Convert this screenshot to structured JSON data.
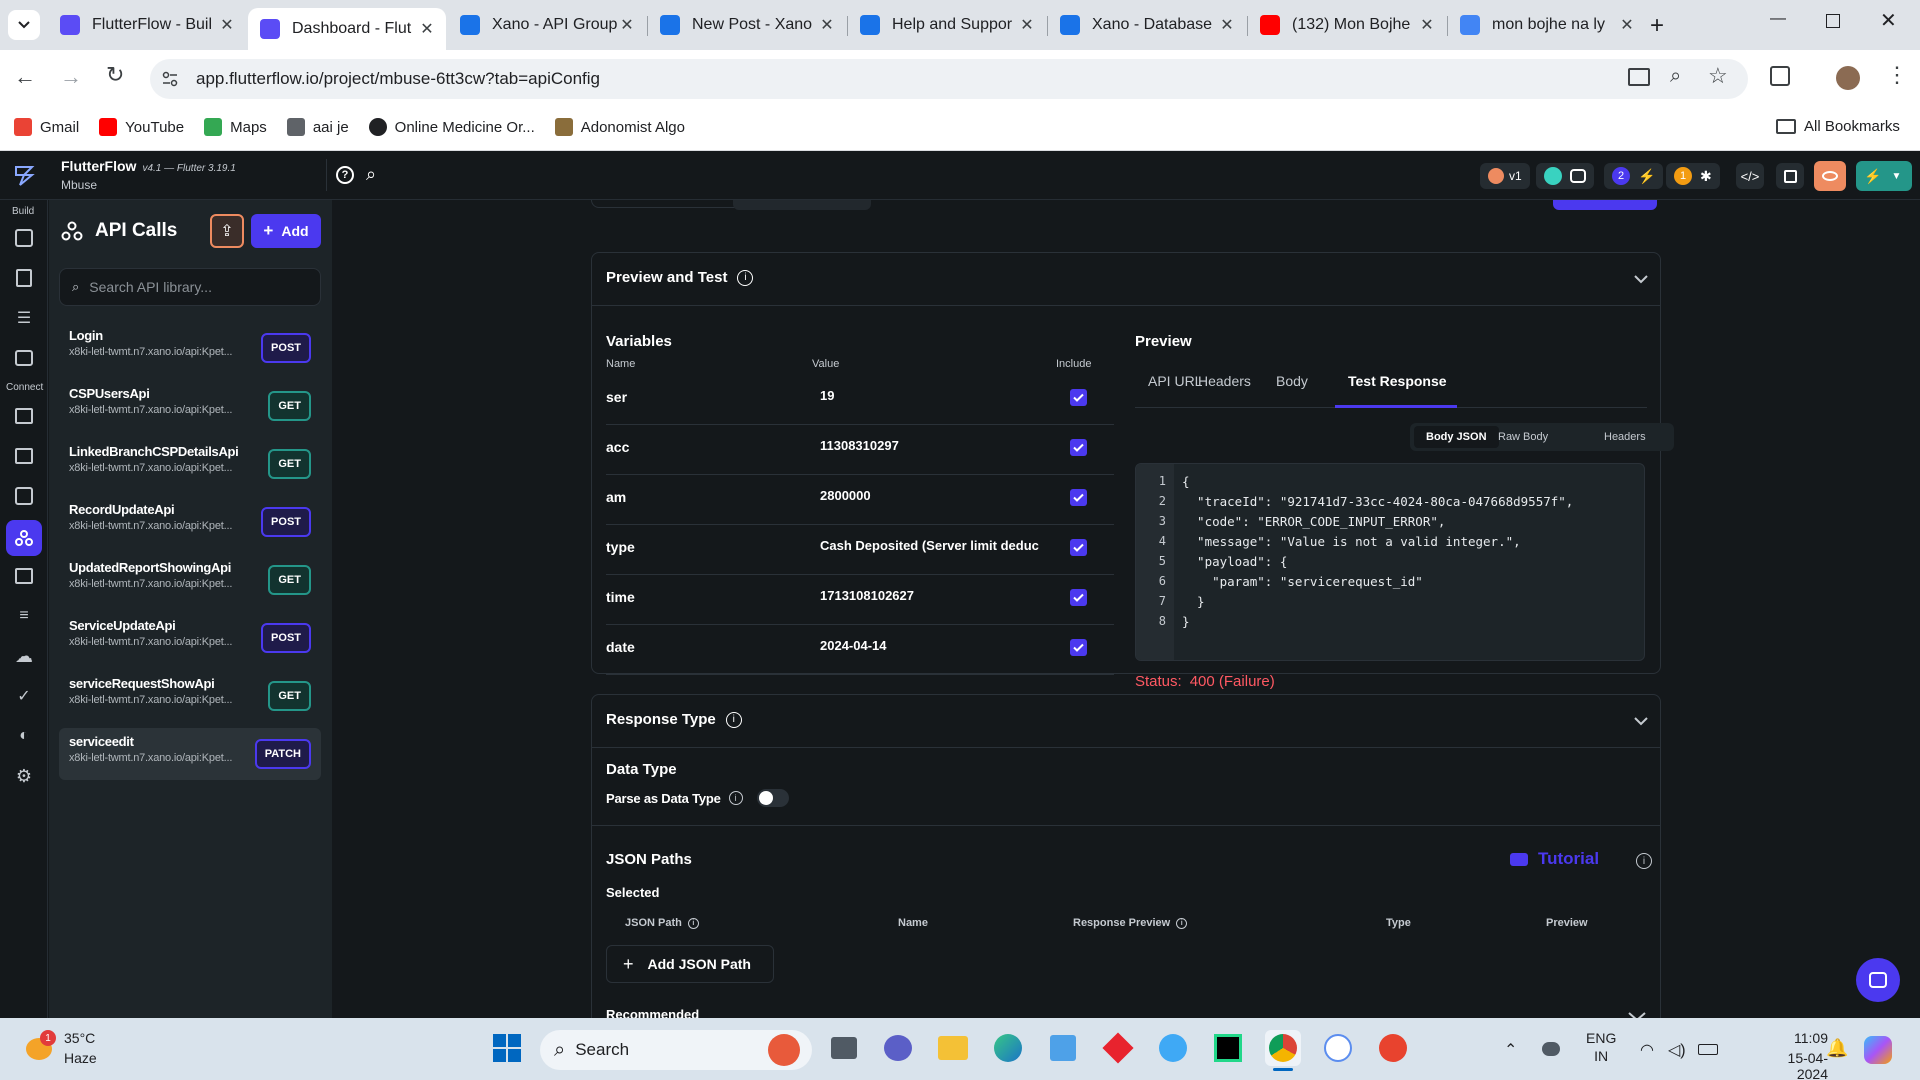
{
  "browser": {
    "tabs": [
      {
        "title": "FlutterFlow - Buil",
        "icon": "flutterflow-icon",
        "color": "#5b4cf5"
      },
      {
        "title": "Dashboard - Flut",
        "icon": "flutterflow-icon",
        "color": "#5b4cf5",
        "active": true
      },
      {
        "title": "Xano - API Group",
        "icon": "xano-icon",
        "color": "#1a73e8"
      },
      {
        "title": "New Post - Xano",
        "icon": "xano-icon",
        "color": "#1a73e8"
      },
      {
        "title": "Help and Suppor",
        "icon": "xano-icon",
        "color": "#1a73e8"
      },
      {
        "title": "Xano - Database",
        "icon": "xano-icon",
        "color": "#1a73e8"
      },
      {
        "title": "(132) Mon Bojhe",
        "icon": "youtube-icon",
        "color": "#ff0000"
      },
      {
        "title": "mon bojhe na ly",
        "icon": "google-icon",
        "color": "#4285f4"
      }
    ],
    "url": "app.flutterflow.io/project/mbuse-6tt3cw?tab=apiConfig",
    "bookmarks": [
      {
        "label": "Gmail",
        "icon": "gmail-icon"
      },
      {
        "label": "YouTube",
        "icon": "youtube-icon"
      },
      {
        "label": "Maps",
        "icon": "maps-icon"
      },
      {
        "label": "aai je",
        "icon": "person-icon"
      },
      {
        "label": "Online Medicine Or...",
        "icon": "globe-icon"
      },
      {
        "label": "Adonomist Algo",
        "icon": "chart-icon"
      }
    ],
    "all_bookmarks": "All Bookmarks"
  },
  "app": {
    "name": "FlutterFlow",
    "version": "v4.1 — Flutter 3.19.1",
    "project": "Mbuse",
    "build_label": "Build",
    "connect_label": "Connect",
    "header_badges": {
      "version": "v1",
      "notif_count": "2",
      "alert_count": "1"
    }
  },
  "sidebar": {
    "title": "API Calls",
    "add_label": "Add",
    "search_placeholder": "Search API library...",
    "items": [
      {
        "name": "Login",
        "url": "x8ki-letl-twmt.n7.xano.io/api:Kpet...",
        "method": "POST"
      },
      {
        "name": "CSPUsersApi",
        "url": "x8ki-letl-twmt.n7.xano.io/api:Kpet...",
        "method": "GET"
      },
      {
        "name": "LinkedBranchCSPDetailsApi",
        "url": "x8ki-letl-twmt.n7.xano.io/api:Kpet...",
        "method": "GET"
      },
      {
        "name": "RecordUpdateApi",
        "url": "x8ki-letl-twmt.n7.xano.io/api:Kpet...",
        "method": "POST"
      },
      {
        "name": "UpdatedReportShowingApi",
        "url": "x8ki-letl-twmt.n7.xano.io/api:Kpet...",
        "method": "GET"
      },
      {
        "name": "ServiceUpdateApi",
        "url": "x8ki-letl-twmt.n7.xano.io/api:Kpet...",
        "method": "POST"
      },
      {
        "name": "serviceRequestShowApi",
        "url": "x8ki-letl-twmt.n7.xano.io/api:Kpet...",
        "method": "GET"
      },
      {
        "name": "serviceedit",
        "url": "x8ki-letl-twmt.n7.xano.io/api:Kpet...",
        "method": "PATCH",
        "selected": true
      }
    ]
  },
  "preview_test": {
    "title": "Preview and Test",
    "variables_title": "Variables",
    "col_name": "Name",
    "col_value": "Value",
    "col_include": "Include",
    "variables": [
      {
        "name": "ser",
        "value": "19"
      },
      {
        "name": "acc",
        "value": "11308310297"
      },
      {
        "name": "am",
        "value": "2800000"
      },
      {
        "name": "type",
        "value": "Cash Deposited (Server limit deduc"
      },
      {
        "name": "time",
        "value": "1713108102627"
      },
      {
        "name": "date",
        "value": "2024-04-14"
      }
    ],
    "preview_title": "Preview",
    "preview_tabs": [
      "API URL",
      "Headers",
      "Body",
      "Test Response"
    ],
    "active_tab": "Test Response",
    "sub_tabs": [
      "Body JSON",
      "Raw Body",
      "Headers"
    ],
    "code_lines": [
      "{",
      "  \"traceId\": \"921741d7-33cc-4024-80ca-047668d9557f\",",
      "  \"code\": \"ERROR_CODE_INPUT_ERROR\",",
      "  \"message\": \"Value is not a valid integer.\",",
      "  \"payload\": {",
      "    \"param\": \"servicerequest_id\"",
      "  }",
      "}"
    ],
    "status_label": "Status:",
    "status_value": "400 (Failure)"
  },
  "response_type": {
    "title": "Response Type",
    "data_type": "Data Type",
    "parse_label": "Parse as Data Type",
    "json_paths": "JSON Paths",
    "tutorial": "Tutorial",
    "selected": "Selected",
    "cols": [
      "JSON Path",
      "Name",
      "Response Preview",
      "Type",
      "Preview"
    ],
    "add_json_path": "Add JSON Path",
    "recommended": "Recommended"
  },
  "taskbar": {
    "temp": "35°C",
    "weather": "Haze",
    "weather_badge": "1",
    "search": "Search",
    "lang1": "ENG",
    "lang2": "IN",
    "time": "11:09",
    "date": "15-04-2024"
  }
}
